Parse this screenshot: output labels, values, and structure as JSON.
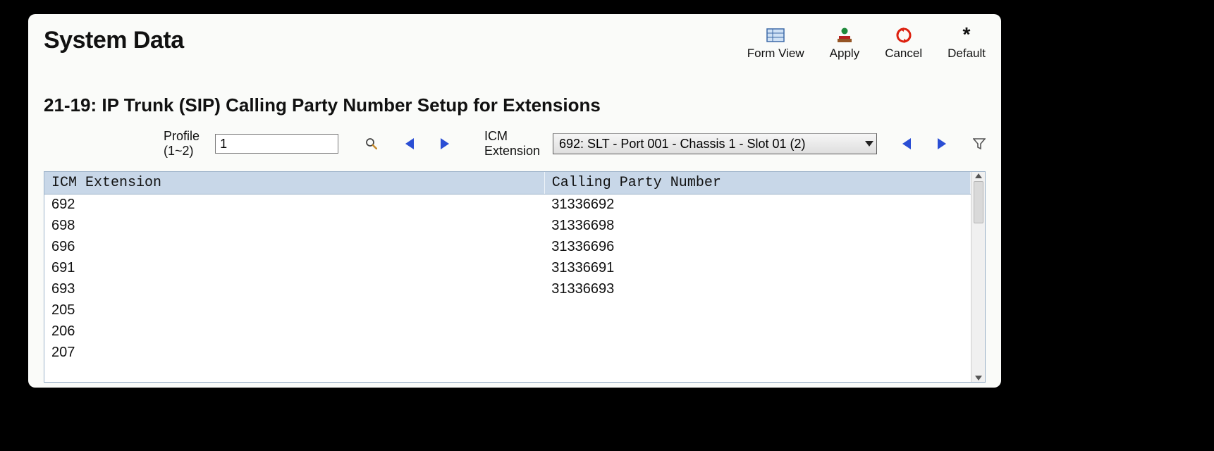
{
  "header": {
    "title": "System Data"
  },
  "toolbar": {
    "form_view": "Form View",
    "apply": "Apply",
    "cancel": "Cancel",
    "default": "Default"
  },
  "section": {
    "title": "21-19: IP Trunk (SIP) Calling Party Number Setup for Extensions"
  },
  "filters": {
    "profile_label": "Profile (1~2)",
    "profile_value": "1",
    "icm_label": "ICM Extension",
    "icm_selected": "692: SLT - Port 001 - Chassis 1 - Slot 01 (2)"
  },
  "table": {
    "columns": [
      "ICM Extension",
      "Calling Party Number"
    ],
    "rows": [
      {
        "ext": "692",
        "num": "31336692"
      },
      {
        "ext": "698",
        "num": "31336698"
      },
      {
        "ext": "696",
        "num": "31336696"
      },
      {
        "ext": "691",
        "num": "31336691"
      },
      {
        "ext": "693",
        "num": "31336693"
      },
      {
        "ext": "205",
        "num": ""
      },
      {
        "ext": "206",
        "num": ""
      },
      {
        "ext": "207",
        "num": ""
      }
    ]
  }
}
